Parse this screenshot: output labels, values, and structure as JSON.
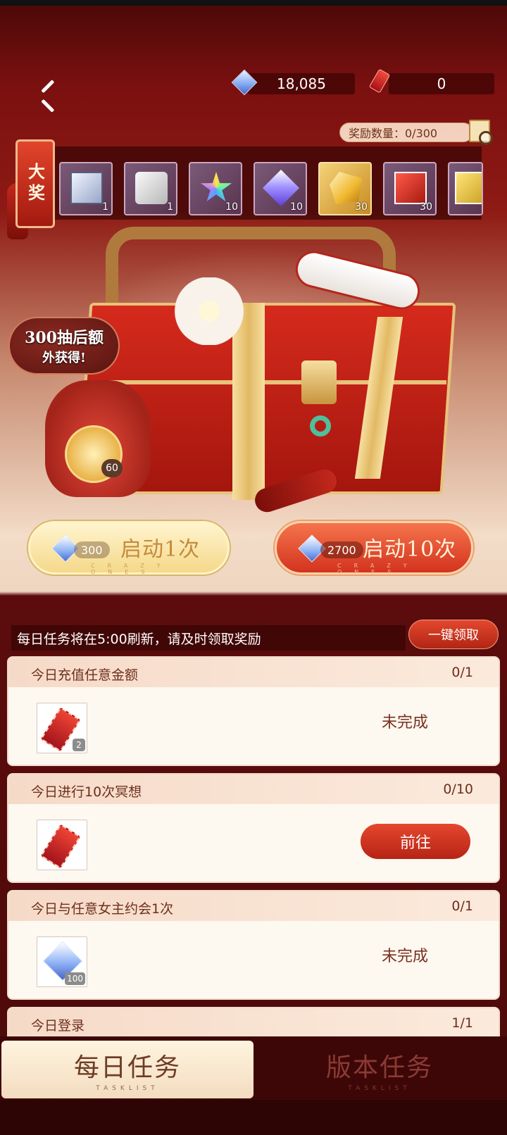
{
  "currency": {
    "gems": "18,085",
    "tickets": "0"
  },
  "reward_count": "奖励数量：0/300",
  "grand_prize": {
    "tag": "大奖",
    "items": [
      {
        "icon": "box-icon",
        "count": "1"
      },
      {
        "icon": "bags-icon",
        "count": "1"
      },
      {
        "icon": "star-icon",
        "count": "10"
      },
      {
        "icon": "purple-gem-icon",
        "count": "10"
      },
      {
        "icon": "gold-gem-icon",
        "count": "30"
      },
      {
        "icon": "red-box-icon",
        "count": "30"
      },
      {
        "icon": "yellow-box-icon",
        "count": ""
      }
    ]
  },
  "bonus": {
    "line1": "300抽后额",
    "line2": "外获得!",
    "count": "60"
  },
  "launch": {
    "one": {
      "cost": "300",
      "label": "启动1次",
      "sub": "CRAZY ONES"
    },
    "ten": {
      "cost": "2700",
      "label": "启动10次",
      "sub": "CRAZY ONES"
    }
  },
  "notice": "每日任务将在5:00刷新，请及时领取奖励",
  "claim_all": "一键领取",
  "tasks": [
    {
      "title": "今日充值任意金额",
      "progress": "0/1",
      "reward_count": "2",
      "status": "未完成"
    },
    {
      "title": "今日进行10次冥想",
      "progress": "0/10",
      "reward_count": "",
      "action": "前往"
    },
    {
      "title": "今日与任意女主约会1次",
      "progress": "0/1",
      "reward_count": "100",
      "status": "未完成"
    },
    {
      "title": "今日登录",
      "progress": "1/1"
    }
  ],
  "tabs": {
    "daily": {
      "label": "每日任务",
      "sub": "TASKLIST"
    },
    "version": {
      "label": "版本任务",
      "sub": "TASKLIST"
    }
  }
}
